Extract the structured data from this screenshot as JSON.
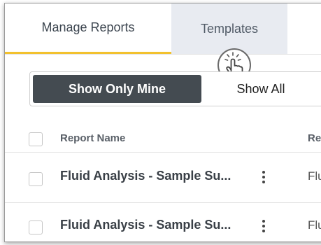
{
  "tabs": [
    {
      "label": "Manage Reports",
      "active": true
    },
    {
      "label": "Templates",
      "active": false
    }
  ],
  "filter": {
    "show_mine_label": "Show Only Mine",
    "show_all_label": "Show All",
    "selected": "Show Only Mine"
  },
  "table": {
    "columns": [
      "Report Name",
      "Re"
    ],
    "rows": [
      {
        "name": "Fluid Analysis - Sample Su...",
        "type": "Flu"
      },
      {
        "name": "Fluid Analysis - Sample Su...",
        "type": "Flu"
      }
    ]
  },
  "colors": {
    "accent": "#f2c12e",
    "active_button": "#444b51",
    "inactive_tab": "#e8ebf1"
  },
  "icons": {
    "cursor": "hand-pointer-click-icon",
    "row_menu": "vertical-ellipsis-icon"
  }
}
